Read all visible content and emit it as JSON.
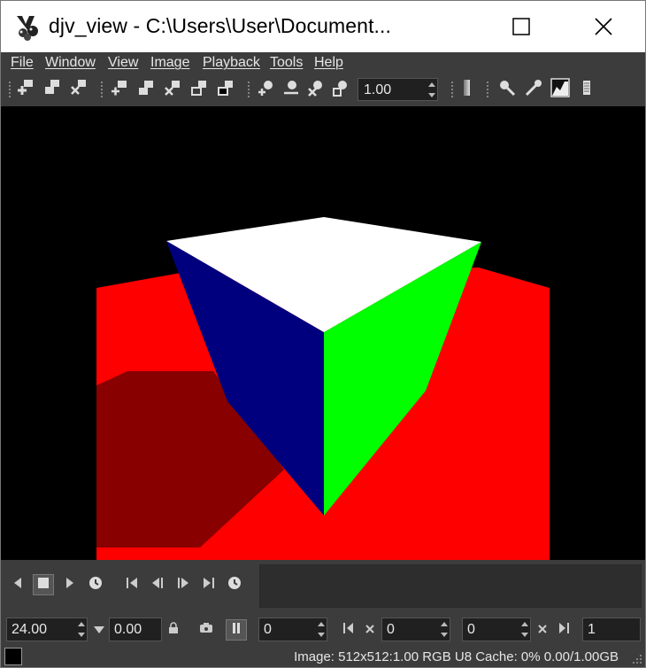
{
  "window": {
    "title": "djv_view - C:\\Users\\User\\Document...",
    "app_icon": "djv-app-icon",
    "maximize_icon": "maximize-icon",
    "close_icon": "close-icon"
  },
  "menu": {
    "items": [
      "File",
      "Window",
      "View",
      "Image",
      "Playback",
      "Tools",
      "Help"
    ]
  },
  "toolbar": {
    "icons": [
      "new-window-icon",
      "copy-window-icon",
      "close-window-icon",
      "fit-window-icon",
      "fit-image-icon",
      "close-file-icon",
      "center-icon",
      "black-icon",
      "zoom-in-icon",
      "zoom-out-icon",
      "zoom-reset-icon",
      "zoom-fit-icon",
      "color-picker-icon",
      "histogram-icon",
      "magnify-icon",
      "info-icon"
    ],
    "zoom_value": "1.00"
  },
  "viewport": {
    "background": "#000000",
    "colors": {
      "red": "#ff0000",
      "dark_red": "#880000",
      "white": "#ffffff",
      "blue": "#00007f",
      "green": "#00ff00"
    }
  },
  "playback": {
    "speed": "24.00",
    "fps": "0.00",
    "frame": "0",
    "in_point": "0",
    "out_point": "0",
    "duration": "1"
  },
  "status": {
    "text": "Image: 512x512:1.00 RGB U8 Cache: 0% 0.00/1.00GB"
  },
  "colors": {
    "panel": "#3c3c3c",
    "field": "#202020",
    "text": "#e6e6e6"
  }
}
